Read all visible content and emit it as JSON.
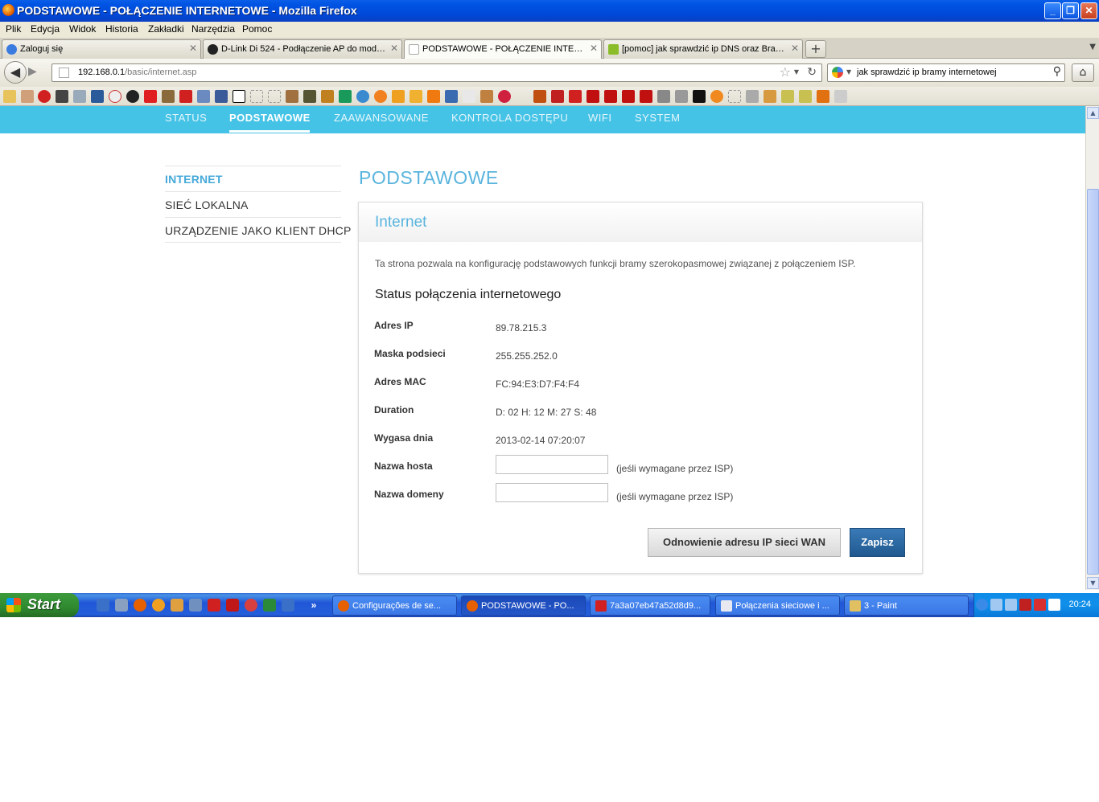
{
  "window": {
    "title": "PODSTAWOWE - POŁĄCZENIE INTERNETOWE - Mozilla Firefox",
    "minimize_label": "_",
    "maximize_label": "❐",
    "close_label": "✕"
  },
  "menu": [
    "Plik",
    "Edycja",
    "Widok",
    "Historia",
    "Zakładki",
    "Narzędzia",
    "Pomoc"
  ],
  "tabs": [
    {
      "label": "Zaloguj się",
      "active": false
    },
    {
      "label": "D-Link Di 524 - Podłączenie AP do modem...",
      "active": false
    },
    {
      "label": "PODSTAWOWE - POŁĄCZENIE INTERNE...",
      "active": true
    },
    {
      "label": "[pomoc] jak sprawdzić ip DNS oraz Brame...",
      "active": false
    }
  ],
  "tab_close": "✕",
  "new_tab": "+",
  "address": {
    "host": "192.168.0.1",
    "path": "/basic/internet.asp"
  },
  "search": {
    "query": "jak sprawdzić ip bramy internetowej"
  },
  "router": {
    "top_nav": [
      "STATUS",
      "PODSTAWOWE",
      "ZAAWANSOWANE",
      "KONTROLA DOSTĘPU",
      "WIFI",
      "SYSTEM"
    ],
    "active_nav": "PODSTAWOWE",
    "side_nav": [
      "INTERNET",
      "SIEĆ LOKALNA",
      "URZĄDZENIE JAKO KLIENT DHCP"
    ],
    "page_title": "PODSTAWOWE",
    "panel": {
      "title": "Internet",
      "description": "Ta strona pozwala na konfigurację podstawowych funkcji bramy szerokopasmowej związanej z połączeniem ISP.",
      "section_title": "Status połączenia internetowego",
      "fields": [
        {
          "label": "Adres IP",
          "value": "89.78.215.3"
        },
        {
          "label": "Maska podsieci",
          "value": "255.255.252.0"
        },
        {
          "label": "Adres MAC",
          "value": "FC:94:E3:D7:F4:F4"
        },
        {
          "label": "Duration",
          "value": "D: 02 H: 12 M: 27 S: 48"
        },
        {
          "label": "Wygasa dnia",
          "value": "2013-02-14 07:20:07"
        }
      ],
      "inputs": [
        {
          "label": "Nazwa hosta",
          "value": "",
          "hint": "(jeśli wymagane przez ISP)"
        },
        {
          "label": "Nazwa domeny",
          "value": "",
          "hint": "(jeśli wymagane przez ISP)"
        }
      ],
      "renew_button": "Odnowienie adresu IP sieci WAN",
      "save_button": "Zapisz"
    }
  },
  "taskbar": {
    "start_label": "Start",
    "overflow": "»",
    "tasks": [
      {
        "label": "Configurações de se...",
        "active": false
      },
      {
        "label": "PODSTAWOWE - PO...",
        "active": true
      },
      {
        "label": "7a3a07eb47a52d8d9...",
        "active": false
      },
      {
        "label": "Połączenia sieciowe i ...",
        "active": false
      },
      {
        "label": "3 - Paint",
        "active": false
      }
    ],
    "clock": "20:24"
  },
  "colors": {
    "router_nav_bg": "#45c3e6",
    "router_accent": "#5ab4dd",
    "save_button_bg": "#20598f",
    "xp_titlebar": "#0054e3",
    "xp_start_green": "#3c9a3c"
  }
}
